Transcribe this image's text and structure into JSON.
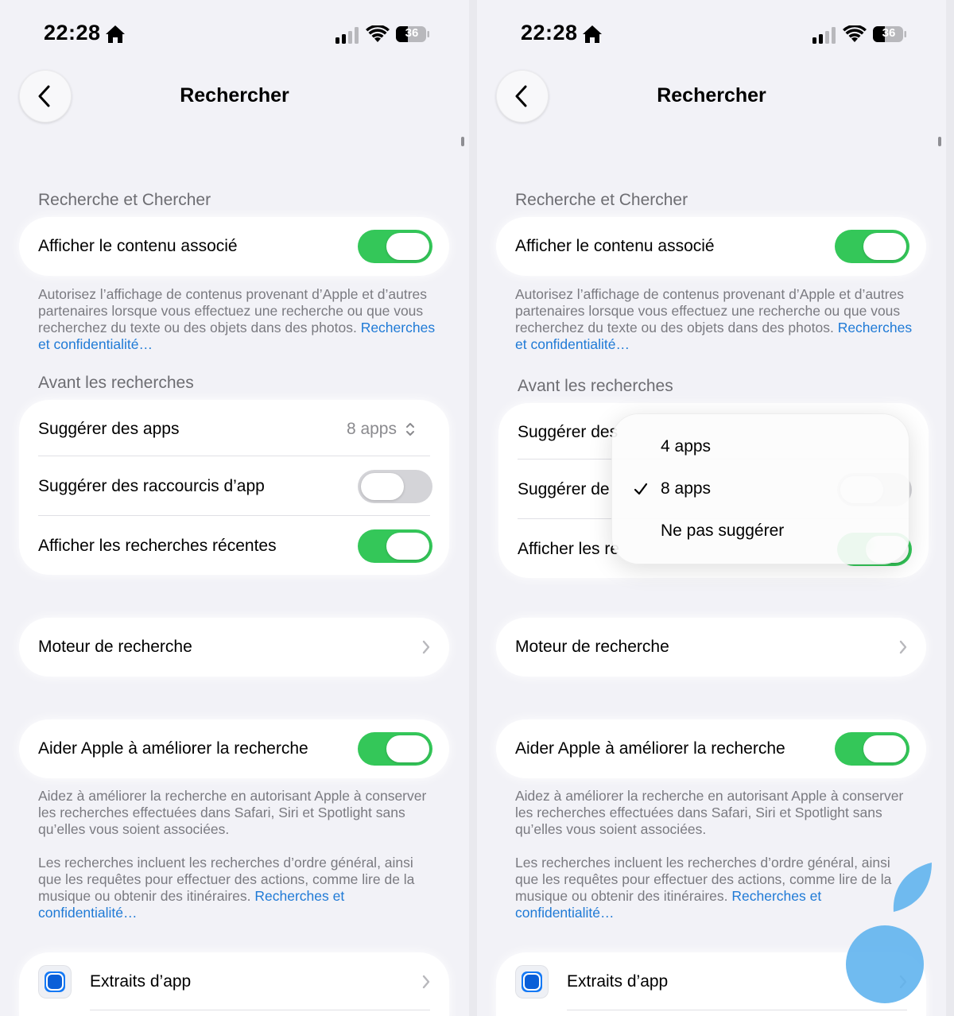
{
  "status_bar": {
    "time": "22:28",
    "battery_level": "36"
  },
  "nav": {
    "title": "Rechercher"
  },
  "sections": {
    "search_header": "Recherche et Chercher",
    "show_related_label": "Afficher le contenu associé",
    "show_related_on": true,
    "related_footer_text": "Autorisez l’affichage de contenus provenant d’Apple et d’autres partenaires lorsque vous effectuez une recherche ou que vous recherchez du texte ou des objets dans des photos. ",
    "related_footer_link": "Recherches et confidentialité…",
    "before_header": "Avant les recherches",
    "suggest_apps_label": "Suggérer des apps",
    "suggest_apps_value": "8 apps",
    "suggest_shortcuts_label": "Suggérer des raccourcis d’app",
    "suggest_shortcuts_on": false,
    "recent_searches_label": "Afficher les recherches récentes",
    "recent_searches_on": true,
    "engine_label": "Moteur de recherche",
    "help_apple_label": "Aider Apple à améliorer la recherche",
    "help_apple_on": true,
    "help_footer_1": "Aidez à améliorer la recherche en autorisant Apple à conserver les recherches effectuées dans Safari, Siri et Spotlight sans qu’elles vous soient associées.",
    "help_footer_2": "Les recherches incluent les recherches d’ordre général, ainsi que les requêtes pour effectuer des actions, comme lire de la musique ou obtenir des itinéraires. ",
    "help_footer_link": "Recherches et confidentialité…",
    "app_extracts_label": "Extraits d’app"
  },
  "right_screen": {
    "truncated_suggest_apps": "Suggérer des",
    "truncated_suggest_shortcuts": "Suggérer de",
    "truncated_recent": "Afficher les re"
  },
  "popup_menu": {
    "options": [
      "4 apps",
      "8 apps",
      "Ne pas suggérer"
    ],
    "selected": "8 apps"
  },
  "colors": {
    "toggle_on": "#34c759",
    "toggle_off": "#d4d4d8",
    "link": "#1f7ad6",
    "background": "#f2f2f7",
    "touch_indicator": "#5cb2ee"
  },
  "icons": [
    "home-icon",
    "signal-icon",
    "wifi-icon",
    "battery-icon",
    "back-chevron-icon",
    "updown-chevron-icon",
    "chevron-right-icon",
    "checkmark-icon",
    "app-extracts-icon"
  ]
}
